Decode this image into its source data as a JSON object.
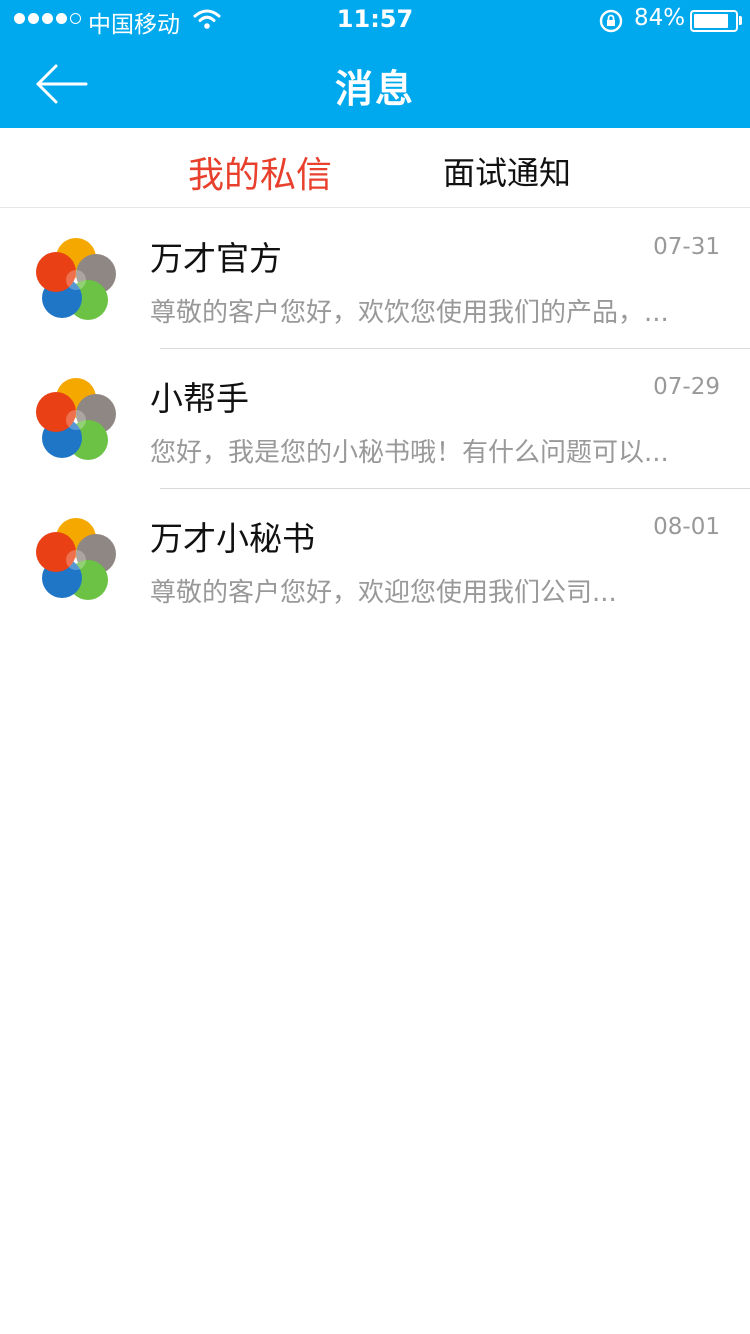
{
  "status_bar": {
    "carrier": "中国移动",
    "time": "11:57",
    "battery": "84%",
    "battery_level": 0.84
  },
  "nav": {
    "title": "消息",
    "back_icon": "arrow-left-icon"
  },
  "tabs": [
    {
      "label": "我的私信",
      "active": true
    },
    {
      "label": "面试通知",
      "active": false
    }
  ],
  "messages": [
    {
      "name": "万才官方",
      "date": "07-31",
      "preview": "尊敬的客户您好，欢饮您使用我们的产品，..."
    },
    {
      "name": "小帮手",
      "date": "07-29",
      "preview": "您好，我是您的小秘书哦！有什么问题可以..."
    },
    {
      "name": "万才小秘书",
      "date": "08-01",
      "preview": "尊敬的客户您好，欢迎您使用我们公司..."
    }
  ],
  "colors": {
    "header": "#00a9ed",
    "active_tab": "#e8402c",
    "logo": [
      "#f5a800",
      "#8e8784",
      "#6cc244",
      "#1f76c6",
      "#e94015"
    ]
  }
}
